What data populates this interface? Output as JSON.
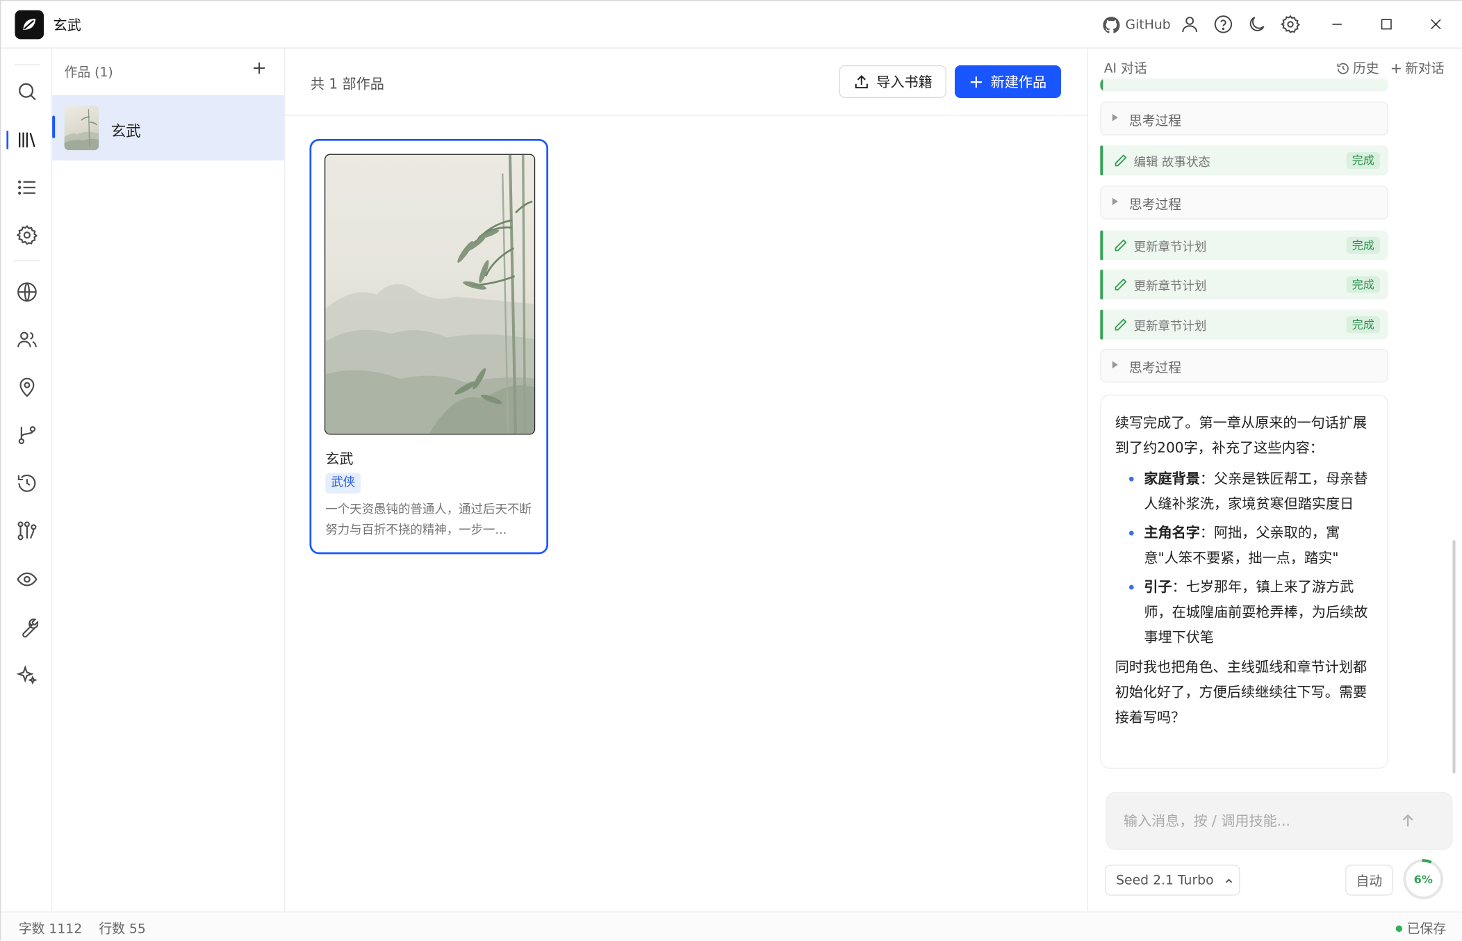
{
  "window": {
    "title": "玄武",
    "github_label": "GitHub"
  },
  "works_sidebar": {
    "header": "作品 (1)",
    "items": [
      {
        "name": "玄武"
      }
    ]
  },
  "main": {
    "count_text": "共 1 部作品",
    "import_label": "导入书籍",
    "new_label": "新建作品",
    "books": [
      {
        "title": "玄武",
        "tag": "武侠",
        "description": "一个天资愚钝的普通人，通过后天不断努力与百折不挠的精神，一步一..."
      }
    ]
  },
  "chat": {
    "title": "AI 对话",
    "history_label": "历史",
    "new_chat_label": "新对话",
    "steps": [
      {
        "kind": "think",
        "label": "思考过程"
      },
      {
        "kind": "tool",
        "label": "编辑 故事状态",
        "status": "完成"
      },
      {
        "kind": "think",
        "label": "思考过程"
      },
      {
        "kind": "tool",
        "label": "更新章节计划",
        "status": "完成"
      },
      {
        "kind": "tool",
        "label": "更新章节计划",
        "status": "完成"
      },
      {
        "kind": "tool",
        "label": "更新章节计划",
        "status": "完成"
      },
      {
        "kind": "think",
        "label": "思考过程"
      }
    ],
    "answer": {
      "intro": "续写完成了。第一章从原来的一句话扩展到了约200字，补充了这些内容：",
      "bullets": [
        {
          "term": "家庭背景",
          "text": "：父亲是铁匠帮工，母亲替人缝补浆洗，家境贫寒但踏实度日"
        },
        {
          "term": "主角名字",
          "text": "：阿拙，父亲取的，寓意\"人笨不要紧，拙一点，踏实\""
        },
        {
          "term": "引子",
          "text": "：七岁那年，镇上来了游方武师，在城隍庙前耍枪弄棒，为后续故事埋下伏笔"
        }
      ],
      "outro": "同时我也把角色、主线弧线和章节计划都初始化好了，方便后续继续往下写。需要接着写吗？"
    },
    "input_placeholder": "输入消息，按 / 调用技能...",
    "model_label": "Seed 2.1 Turbo",
    "auto_label": "自动",
    "usage_percent": 6,
    "usage_label": "6%"
  },
  "status_bar": {
    "word_count": "字数 1112",
    "line_count": "行数 55",
    "saved_label": "已保存"
  },
  "colors": {
    "accent": "#1a56ff",
    "success": "#37a158",
    "selected_bg": "#e4ebfb"
  }
}
